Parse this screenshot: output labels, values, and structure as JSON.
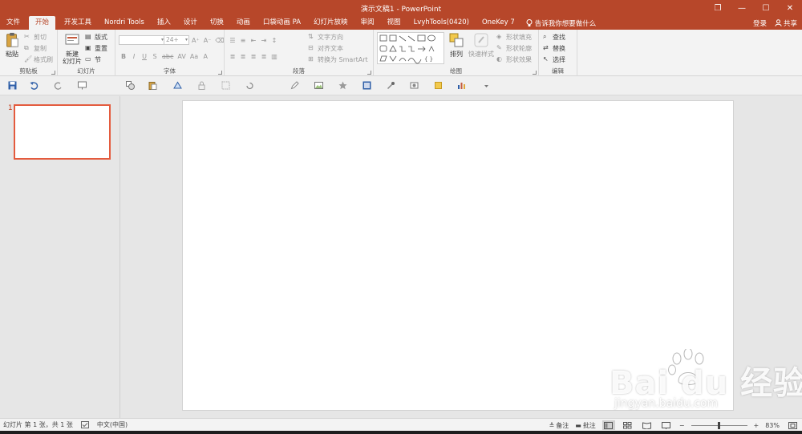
{
  "window": {
    "title": "演示文稿1 - PowerPoint",
    "controls": {
      "restore": "❐",
      "minimize": "—",
      "maximize": "☐",
      "close": "✕"
    }
  },
  "tabs": [
    {
      "label": "文件"
    },
    {
      "label": "开始",
      "active": true
    },
    {
      "label": "开发工具"
    },
    {
      "label": "Nordri Tools"
    },
    {
      "label": "插入"
    },
    {
      "label": "设计"
    },
    {
      "label": "切换"
    },
    {
      "label": "动画"
    },
    {
      "label": "口袋动画 PA"
    },
    {
      "label": "幻灯片放映"
    },
    {
      "label": "审阅"
    },
    {
      "label": "视图"
    },
    {
      "label": "LvyhTools(0420)"
    },
    {
      "label": "OneKey 7"
    }
  ],
  "tell_me": "告诉我你想要做什么",
  "account": {
    "signin": "登录",
    "share": "共享"
  },
  "ribbon": {
    "clipboard": {
      "label": "剪贴板",
      "paste": "粘贴",
      "cut": "剪切",
      "copy": "复制",
      "format_painter": "格式刷"
    },
    "slides": {
      "label": "幻灯片",
      "new_slide": "新建\n幻灯片",
      "layout": "版式",
      "reset": "重置",
      "section": "节"
    },
    "font": {
      "label": "字体",
      "font_name": "",
      "font_size": "24+"
    },
    "paragraph": {
      "label": "段落",
      "text_direction": "文字方向",
      "align_text": "对齐文本",
      "smartart": "转换为 SmartArt"
    },
    "drawing": {
      "label": "绘图",
      "arrange": "排列",
      "quick_styles": "快速样式",
      "shape_fill": "形状填充",
      "shape_outline": "形状轮廓",
      "shape_effects": "形状效果"
    },
    "editing": {
      "label": "编辑",
      "find": "查找",
      "replace": "替换",
      "select": "选择"
    }
  },
  "slides_pane": {
    "slide_number": "1"
  },
  "status": {
    "slide_info": "幻灯片 第 1 张，共 1 张",
    "language": "中文(中国)",
    "notes": "备注",
    "comments": "批注",
    "zoom": "83%",
    "zoom_fraction": 0.5
  },
  "watermark": {
    "brand": "Bai du 经验",
    "url": "jingyan.baidu.com"
  },
  "colors": {
    "accent": "#b7472a",
    "thumb_border": "#e45b3e"
  }
}
